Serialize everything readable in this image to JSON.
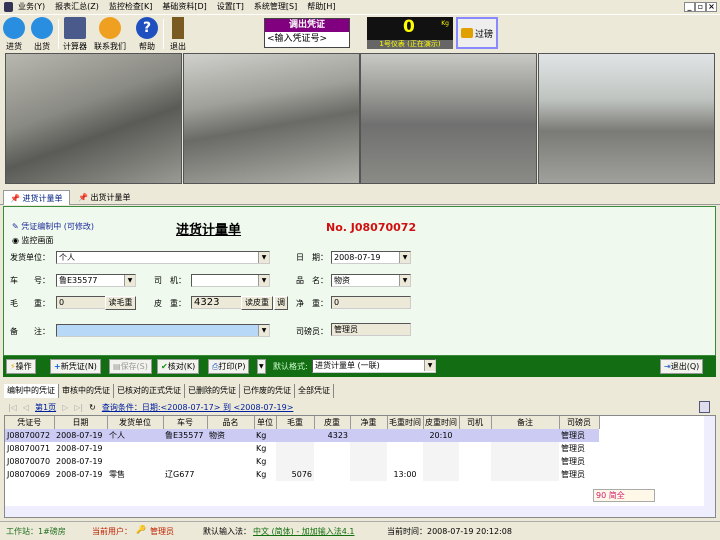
{
  "menu": [
    "业务(Y)",
    "报表汇总(Z)",
    "监控检查[K]",
    "基础资料[D]",
    "设置[T]",
    "系统管理[S]",
    "帮助[H]"
  ],
  "toolbar": {
    "in": "进货",
    "out": "出货",
    "calc": "计算器",
    "contact": "联系我们",
    "help": "帮助",
    "exit": "退出"
  },
  "voucher": {
    "title": "调出凭证",
    "placeholder": "<输入凭证号>"
  },
  "meter": {
    "value": "0",
    "unit": "Kg",
    "label": "1号仪表 (正在演示)"
  },
  "weigh_button": "过磅",
  "tabs": [
    "进货计量单",
    "出货计量单"
  ],
  "form": {
    "status": "凭证编制中 (可修改)",
    "monitor": "监控画面",
    "title": "进货计量单",
    "number": "No. J08070072",
    "sender_label": "发货单位：",
    "sender": "个人",
    "date_label": "日　期：",
    "date": "2008-07-19",
    "car_label": "车　　号：",
    "car": "鲁E35577",
    "driver_label": "司　机：",
    "driver": "",
    "product_label": "品　名：",
    "product": "物资",
    "gross_label": "毛　　重：",
    "gross": "0",
    "read_gross": "读毛重",
    "tare_label": "皮　重：",
    "tare": "4323",
    "read_tare": "读皮重",
    "adjust": "调",
    "net_label": "净　重：",
    "net": "0",
    "note_label": "备　　注：",
    "note": "",
    "operator_label": "司磅员：",
    "operator": "管理员"
  },
  "actions": {
    "op": "操作",
    "new": "新凭证(N)",
    "save": "保存(S)",
    "check": "核对(K)",
    "print": "打印(P)",
    "format_label": "默认格式:",
    "format": "进货计量单 (一联)",
    "exit": "退出(Q)"
  },
  "list_tabs": [
    "编制中的凭证",
    "审核中的凭证",
    "已核对的正式凭证",
    "已删除的凭证",
    "已作废的凭证",
    "全部凭证"
  ],
  "nav": {
    "page": "第1页",
    "query": "查询条件：日期:<2008-07-17> 到 <2008-07-19>"
  },
  "columns": [
    "凭证号",
    "日期",
    "发货单位",
    "车号",
    "品名",
    "单位",
    "毛重",
    "皮重",
    "净重",
    "毛重时间",
    "皮重时间",
    "司机",
    "备注",
    "司磅员"
  ],
  "rows": [
    [
      "J08070072",
      "2008-07-19",
      "个人",
      "鲁E35577",
      "物资",
      "Kg",
      "",
      "4323",
      "",
      "",
      "20:10",
      "",
      "",
      "管理员"
    ],
    [
      "J08070071",
      "2008-07-19",
      "",
      "",
      "",
      "Kg",
      "",
      "",
      "",
      "",
      "",
      "",
      "",
      "管理员"
    ],
    [
      "J08070070",
      "2008-07-19",
      "",
      "",
      "",
      "Kg",
      "",
      "",
      "",
      "",
      "",
      "",
      "",
      "管理员"
    ],
    [
      "J08070069",
      "2008-07-19",
      "零售",
      "辽G677",
      "",
      "Kg",
      "5076",
      "",
      "",
      "13:00",
      "",
      "",
      "",
      "管理员"
    ]
  ],
  "ime": "90 简全",
  "status": {
    "station": "工作站：1#磅房",
    "user_label": "当前用户：",
    "user": "管理员",
    "ime_label": "默认输入法：",
    "ime": "中文 (简体) - 加加输入法4.1",
    "time": "当前时间：2008-07-19 20:12:08"
  }
}
